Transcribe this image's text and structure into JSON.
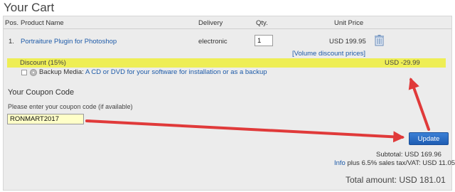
{
  "page": {
    "title": "Your Cart"
  },
  "table": {
    "headers": {
      "pos": "Pos.",
      "product": "Product Name",
      "delivery": "Delivery",
      "qty": "Qty.",
      "unit_price": "Unit Price"
    },
    "rows": [
      {
        "pos": "1.",
        "product": "Portraiture Plugin for Photoshop",
        "delivery": "electronic",
        "qty": "1",
        "unit_price": "USD 199.95"
      }
    ],
    "volume_link": "[Volume discount prices]"
  },
  "discount": {
    "label": "Discount (15%)",
    "value": "USD -29.99",
    "highlight_color": "#eeee55"
  },
  "backup": {
    "label": "Backup Media:",
    "link": "A CD or DVD for your software for installation or as a backup"
  },
  "coupon": {
    "title": "Your Coupon Code",
    "hint": "Please enter your coupon code (if available)",
    "value": "RONMART2017",
    "input_bg": "#ffffc8"
  },
  "update_button": "Update",
  "summary": {
    "subtotal": "Subtotal: USD 169.96",
    "tax_info_link": "Info",
    "tax": "plus 6.5% sales tax/VAT: USD 11.05",
    "total": "Total amount: USD 181.01"
  },
  "colors": {
    "link": "#1d5aa8",
    "button": "#2a6cc4",
    "arrow": "#e03a3a"
  }
}
